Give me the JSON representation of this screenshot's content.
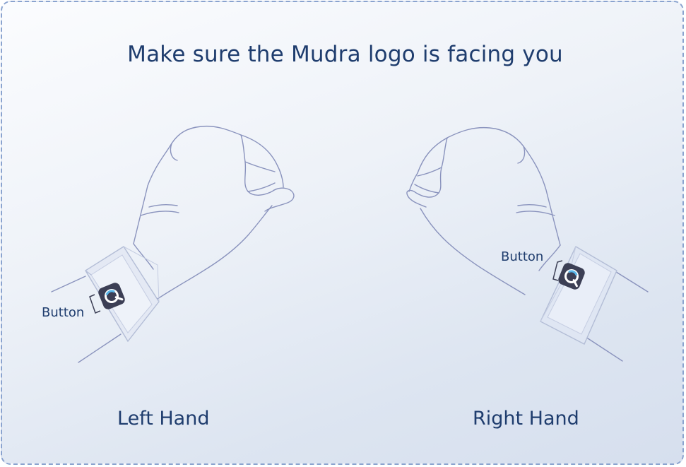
{
  "title": "Make sure the Mudra logo is facing you",
  "left": {
    "button_label": "Button",
    "hand_label": "Left Hand"
  },
  "right": {
    "button_label": "Button",
    "hand_label": "Right Hand"
  },
  "colors": {
    "text": "#1f3d6e",
    "outline": "#8a93bd",
    "border": "#8aa3cf",
    "logo_bg": "#3c3f55",
    "logo_accent": "#5ab7ea"
  }
}
